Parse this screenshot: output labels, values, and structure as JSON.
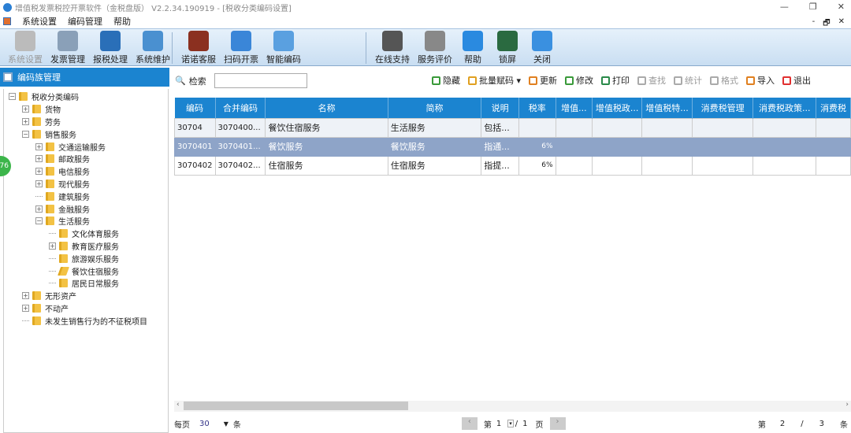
{
  "window": {
    "title": "增值税发票税控开票软件（金税盘版） V2.2.34.190919 - [税收分类编码设置]",
    "min": "—",
    "max": "❐",
    "close": "✕"
  },
  "menu": {
    "items": [
      "系统设置",
      "编码管理",
      "帮助"
    ],
    "mdi": [
      "-",
      "🗗",
      "✕"
    ]
  },
  "toolbar": {
    "left": [
      {
        "label": "系统设置",
        "color": "#bbbbbb",
        "disabled": true
      },
      {
        "label": "发票管理",
        "color": "#8aa0b8"
      },
      {
        "label": "报税处理",
        "color": "#2a6fb8"
      },
      {
        "label": "系统维护",
        "color": "#4a90d0"
      },
      {
        "label": "诺诺客服",
        "color": "#8b3020"
      },
      {
        "label": "扫码开票",
        "color": "#3a86d8"
      },
      {
        "label": "智能编码",
        "color": "#5aa0e0"
      }
    ],
    "right": [
      {
        "label": "在线支持",
        "color": "#555555"
      },
      {
        "label": "服务评价",
        "color": "#888888"
      },
      {
        "label": "帮助",
        "color": "#2a8ae0"
      },
      {
        "label": "锁屏",
        "color": "#2a6a40"
      },
      {
        "label": "关闭",
        "color": "#3a90e0"
      }
    ]
  },
  "sidebar": {
    "title": "编码族管理",
    "badge": "76",
    "tree": [
      {
        "label": "税收分类编码",
        "level": 0,
        "toggle": "-"
      },
      {
        "label": "货物",
        "level": 1,
        "toggle": "+"
      },
      {
        "label": "劳务",
        "level": 1,
        "toggle": "+"
      },
      {
        "label": "销售服务",
        "level": 1,
        "toggle": "-"
      },
      {
        "label": "交通运输服务",
        "level": 2,
        "toggle": "+"
      },
      {
        "label": "邮政服务",
        "level": 2,
        "toggle": "+"
      },
      {
        "label": "电信服务",
        "level": 2,
        "toggle": "+"
      },
      {
        "label": "现代服务",
        "level": 2,
        "toggle": "+"
      },
      {
        "label": "建筑服务",
        "level": 2,
        "toggle": ""
      },
      {
        "label": "金融服务",
        "level": 2,
        "toggle": "+"
      },
      {
        "label": "生活服务",
        "level": 2,
        "toggle": "-"
      },
      {
        "label": "文化体育服务",
        "level": 3,
        "toggle": ""
      },
      {
        "label": "教育医疗服务",
        "level": 3,
        "toggle": "+"
      },
      {
        "label": "旅游娱乐服务",
        "level": 3,
        "toggle": ""
      },
      {
        "label": "餐饮住宿服务",
        "level": 3,
        "toggle": "",
        "open": true
      },
      {
        "label": "居民日常服务",
        "level": 3,
        "toggle": ""
      },
      {
        "label": "无形资产",
        "level": 1,
        "toggle": "+"
      },
      {
        "label": "不动产",
        "level": 1,
        "toggle": "+"
      },
      {
        "label": "未发生销售行为的不征税项目",
        "level": 1,
        "toggle": ""
      }
    ]
  },
  "search": {
    "label": "检索",
    "value": ""
  },
  "actions": [
    {
      "label": "隐藏",
      "color": "#3a9a3a"
    },
    {
      "label": "批量赋码 ▾",
      "color": "#e0a020"
    },
    {
      "label": "更新",
      "color": "#e08020"
    },
    {
      "label": "修改",
      "color": "#3a9a3a"
    },
    {
      "label": "打印",
      "color": "#2a8a4a"
    },
    {
      "label": "查找",
      "color": "#aaaaaa",
      "disabled": true
    },
    {
      "label": "统计",
      "color": "#aaaaaa",
      "disabled": true
    },
    {
      "label": "格式",
      "color": "#aaaaaa",
      "disabled": true
    },
    {
      "label": "导入",
      "color": "#e08020"
    },
    {
      "label": "退出",
      "color": "#e03030"
    }
  ],
  "table": {
    "columns": [
      "编码",
      "合并编码",
      "名称",
      "简称",
      "说明",
      "税率",
      "增值...",
      "增值税政...",
      "增值税特...",
      "消费税管理",
      "消费税政策...",
      "消费税"
    ],
    "rows": [
      [
        "30704",
        "3070400...",
        "餐饮住宿服务",
        "生活服务",
        "包括...",
        "",
        "",
        "",
        "",
        "",
        "",
        ""
      ],
      [
        "3070401",
        "3070401...",
        "餐饮服务",
        "餐饮服务",
        "指通...",
        "6%",
        "",
        "",
        "",
        "",
        "",
        ""
      ],
      [
        "3070402",
        "3070402...",
        "住宿服务",
        "住宿服务",
        "指提...",
        "6%",
        "",
        "",
        "",
        "",
        "",
        ""
      ]
    ],
    "selected_row": 1
  },
  "footer": {
    "per_page_label": "每页",
    "per_page": "30",
    "unit": "条",
    "page_prefix": "第",
    "page": "1",
    "page_sep": "/",
    "total_pages": "1",
    "page_suffix": "页",
    "record_prefix": "第",
    "record": "2",
    "record_sep": "/",
    "record_total": "3",
    "record_suffix": "条"
  }
}
